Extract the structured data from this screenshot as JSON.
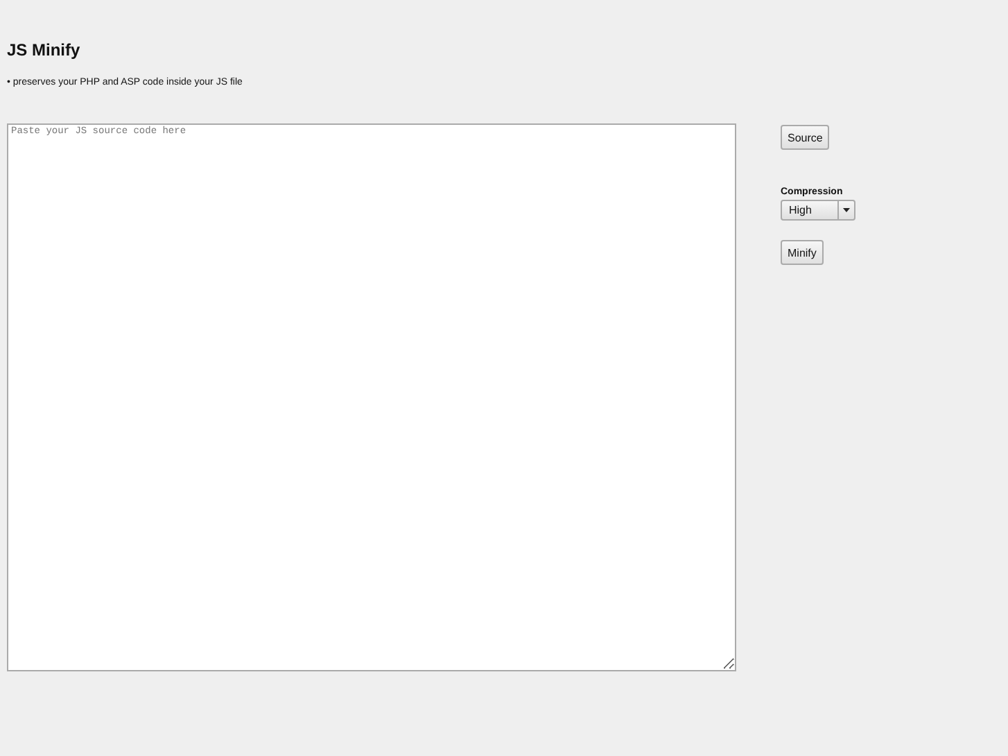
{
  "title": "JS Minify",
  "subtitle": "• preserves your PHP and ASP code inside your JS file",
  "editor": {
    "placeholder": "Paste your JS source code here"
  },
  "source_button": "Source",
  "compression": {
    "label": "Compression",
    "value": "High"
  },
  "minify_button": "Minify"
}
